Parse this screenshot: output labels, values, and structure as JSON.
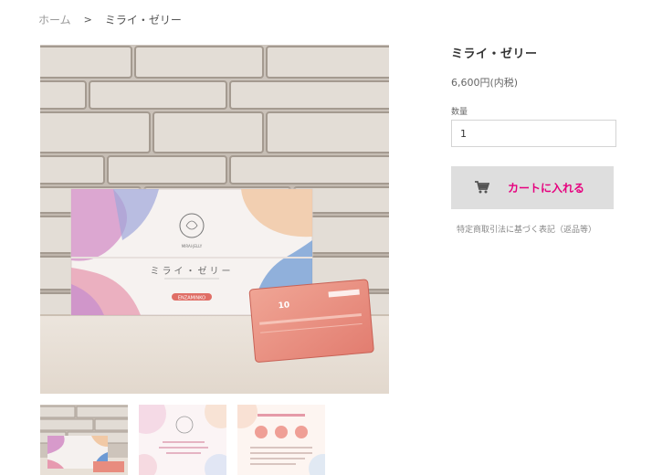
{
  "breadcrumb": {
    "home": "ホーム",
    "separator": ">",
    "current": "ミライ・ゼリー"
  },
  "product": {
    "title": "ミライ・ゼリー",
    "price": "6,600円(内税)",
    "quantity_label": "数量",
    "quantity_value": "1",
    "add_to_cart_label": "カートに入れる",
    "legal_link": "特定商取引法に基づく表記（返品等）"
  },
  "photo": {
    "box_brand": "ミライ・ゼリー",
    "box_tag": "ENZAMINKO",
    "stick_number": "10"
  },
  "thumbnails": [
    {
      "name": "thumb-product-photo"
    },
    {
      "name": "thumb-box-design"
    },
    {
      "name": "thumb-info-sheet"
    }
  ],
  "colors": {
    "accent": "#e6007e",
    "button_bg": "#dedede",
    "text": "#333333",
    "muted": "#999999"
  }
}
